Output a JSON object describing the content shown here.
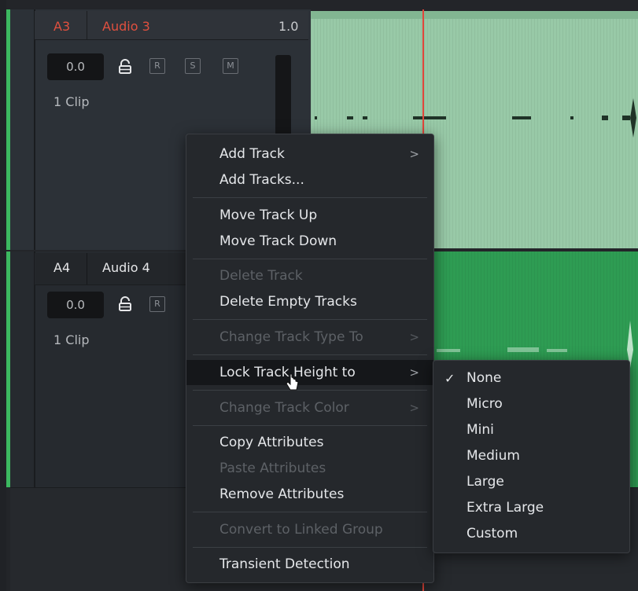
{
  "tracks": {
    "a3": {
      "id": "A3",
      "name": "Audio 3",
      "level": "1.0",
      "volume": "0.0",
      "buttons": [
        "R",
        "S",
        "M"
      ],
      "clips": "1 Clip",
      "id_color": "#e0503f"
    },
    "a4": {
      "id": "A4",
      "name": "Audio 4",
      "volume": "0.0",
      "buttons": [
        "R"
      ],
      "clips": "1 Clip"
    }
  },
  "context_menu": {
    "items": [
      {
        "label": "Add Track",
        "submenu": true,
        "enabled": true
      },
      {
        "label": "Add Tracks...",
        "enabled": true
      },
      {
        "label": "Move Track Up",
        "enabled": true
      },
      {
        "label": "Move Track Down",
        "enabled": true
      },
      {
        "label": "Delete Track",
        "enabled": false
      },
      {
        "label": "Delete Empty Tracks",
        "enabled": true
      },
      {
        "label": "Change Track Type To",
        "submenu": true,
        "enabled": false
      },
      {
        "label": "Lock Track Height to",
        "submenu": true,
        "enabled": true,
        "active": true
      },
      {
        "label": "Change Track Color",
        "submenu": true,
        "enabled": false
      },
      {
        "label": "Copy Attributes",
        "enabled": true
      },
      {
        "label": "Paste Attributes",
        "enabled": false
      },
      {
        "label": "Remove Attributes",
        "enabled": true
      },
      {
        "label": "Convert to Linked Group",
        "enabled": false
      },
      {
        "label": "Transient Detection",
        "enabled": true
      }
    ],
    "chevron": ">"
  },
  "submenu": {
    "selected": "None",
    "check": "✓",
    "items": [
      "None",
      "Micro",
      "Mini",
      "Medium",
      "Large",
      "Extra Large",
      "Custom"
    ]
  },
  "icons": {
    "lock": "lock-icon",
    "submenu_chevron": "chevron-right-icon",
    "checkmark": "checkmark-icon",
    "cursor": "pointer-cursor-icon"
  },
  "colors": {
    "playhead": "#e1453a",
    "track_edge": "#3cb860",
    "clip_a3": "#98c9a7",
    "clip_a4": "#2e9c53"
  }
}
